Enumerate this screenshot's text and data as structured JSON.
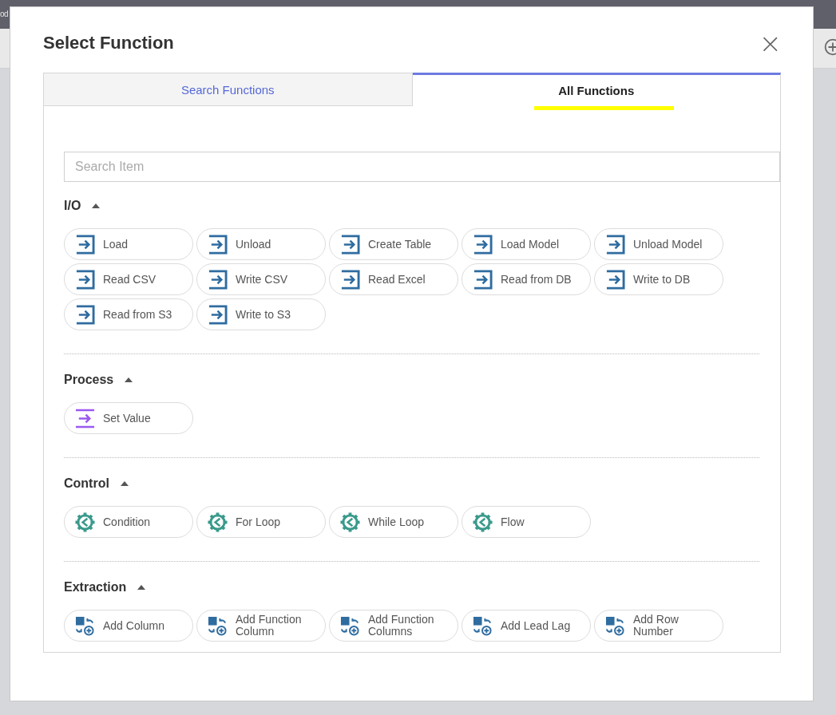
{
  "background": {
    "tab_text": "od"
  },
  "dialog": {
    "title": "Select Function",
    "close_label": "×"
  },
  "tabs": [
    {
      "label": "Search Functions",
      "selected": false,
      "highlighted": false
    },
    {
      "label": "All Functions",
      "selected": true,
      "highlighted": true
    }
  ],
  "search": {
    "placeholder": "Search Item"
  },
  "sections": [
    {
      "title": "I/O",
      "expanded": true,
      "kind": "io",
      "items": [
        {
          "label": "Load"
        },
        {
          "label": "Unload"
        },
        {
          "label": "Create Table"
        },
        {
          "label": "Load Model"
        },
        {
          "label": "Unload Model"
        },
        {
          "label": "Read CSV"
        },
        {
          "label": "Write CSV"
        },
        {
          "label": "Read Excel"
        },
        {
          "label": "Read from DB"
        },
        {
          "label": "Write to DB"
        },
        {
          "label": "Read from S3"
        },
        {
          "label": "Write to S3"
        }
      ]
    },
    {
      "title": "Process",
      "expanded": true,
      "kind": "process",
      "items": [
        {
          "label": "Set Value"
        }
      ]
    },
    {
      "title": "Control",
      "expanded": true,
      "kind": "control",
      "items": [
        {
          "label": "Condition"
        },
        {
          "label": "For Loop"
        },
        {
          "label": "While Loop"
        },
        {
          "label": "Flow"
        }
      ]
    },
    {
      "title": "Extraction",
      "expanded": true,
      "kind": "extraction",
      "items": [
        {
          "label": "Add Column"
        },
        {
          "label": "Add Function Column"
        },
        {
          "label": "Add Function Columns"
        },
        {
          "label": "Add Lead Lag"
        },
        {
          "label": "Add Row Number"
        }
      ]
    }
  ]
}
